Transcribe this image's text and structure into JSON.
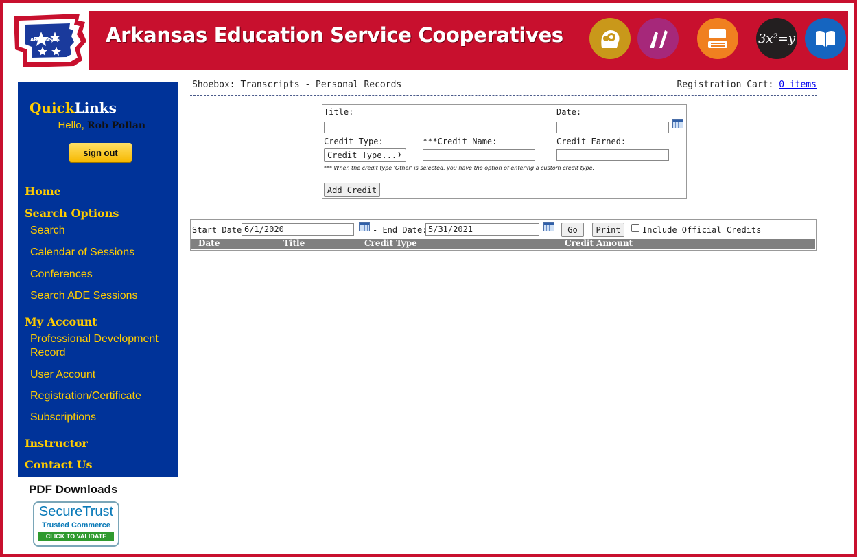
{
  "header": {
    "title": "Arkansas Education Service Cooperatives",
    "logo_text": "ARKANSAS",
    "circle_icons": [
      "brain-gears-icon",
      "art-brush-icon",
      "computer-icon",
      "math-icon",
      "book-icon"
    ],
    "math_text": "3x²=y"
  },
  "sidebar": {
    "quicklinks_a": "Quick",
    "quicklinks_b": "Links",
    "hello": "Hello,",
    "user_name": "Rob Pollan",
    "sign_out": "sign out",
    "home": "Home",
    "search_options": "Search Options",
    "search": "Search",
    "calendar": "Calendar of Sessions",
    "conferences": "Conferences",
    "search_ade": "Search ADE Sessions",
    "my_account": "My Account",
    "pd_record_1": "Professional Development",
    "pd_record_2": "Record",
    "user_account": "User Account",
    "registration": "Registration/Certificate",
    "subscriptions": "Subscriptions",
    "instructor": "Instructor",
    "contact_us": "Contact Us"
  },
  "footer": {
    "pdf_downloads": "PDF Downloads",
    "trust_line1": "SecureTrust",
    "trust_line2": "Trusted Commerce",
    "trust_line3": "CLICK TO VALIDATE"
  },
  "breadcrumb": {
    "text": "Shoebox: Transcripts - Personal Records",
    "cart_label": "Registration Cart:",
    "cart_link": "0 items"
  },
  "form": {
    "title_label": "Title:",
    "date_label": "Date:",
    "credit_type_label": "Credit Type:",
    "credit_name_label": "***Credit Name:",
    "credit_earned_label": "Credit Earned:",
    "credit_type_selected": "Credit Type...",
    "note": "*** When the credit type 'Other' is selected, you have the option of entering a custom credit type.",
    "add_button": "Add Credit"
  },
  "filter": {
    "start_label": "Start Date",
    "start_value": "6/1/2020",
    "end_label": "- End Date:",
    "end_value": "5/31/2021",
    "go": "Go",
    "print": "Print",
    "include_official": "Include Official Credits",
    "columns": [
      "Date",
      "Title",
      "Credit Type",
      "Credit Amount"
    ]
  },
  "colors": {
    "brand_red": "#c8102e",
    "sidebar_blue": "#003399",
    "nav_yellow": "#ffcc00"
  }
}
